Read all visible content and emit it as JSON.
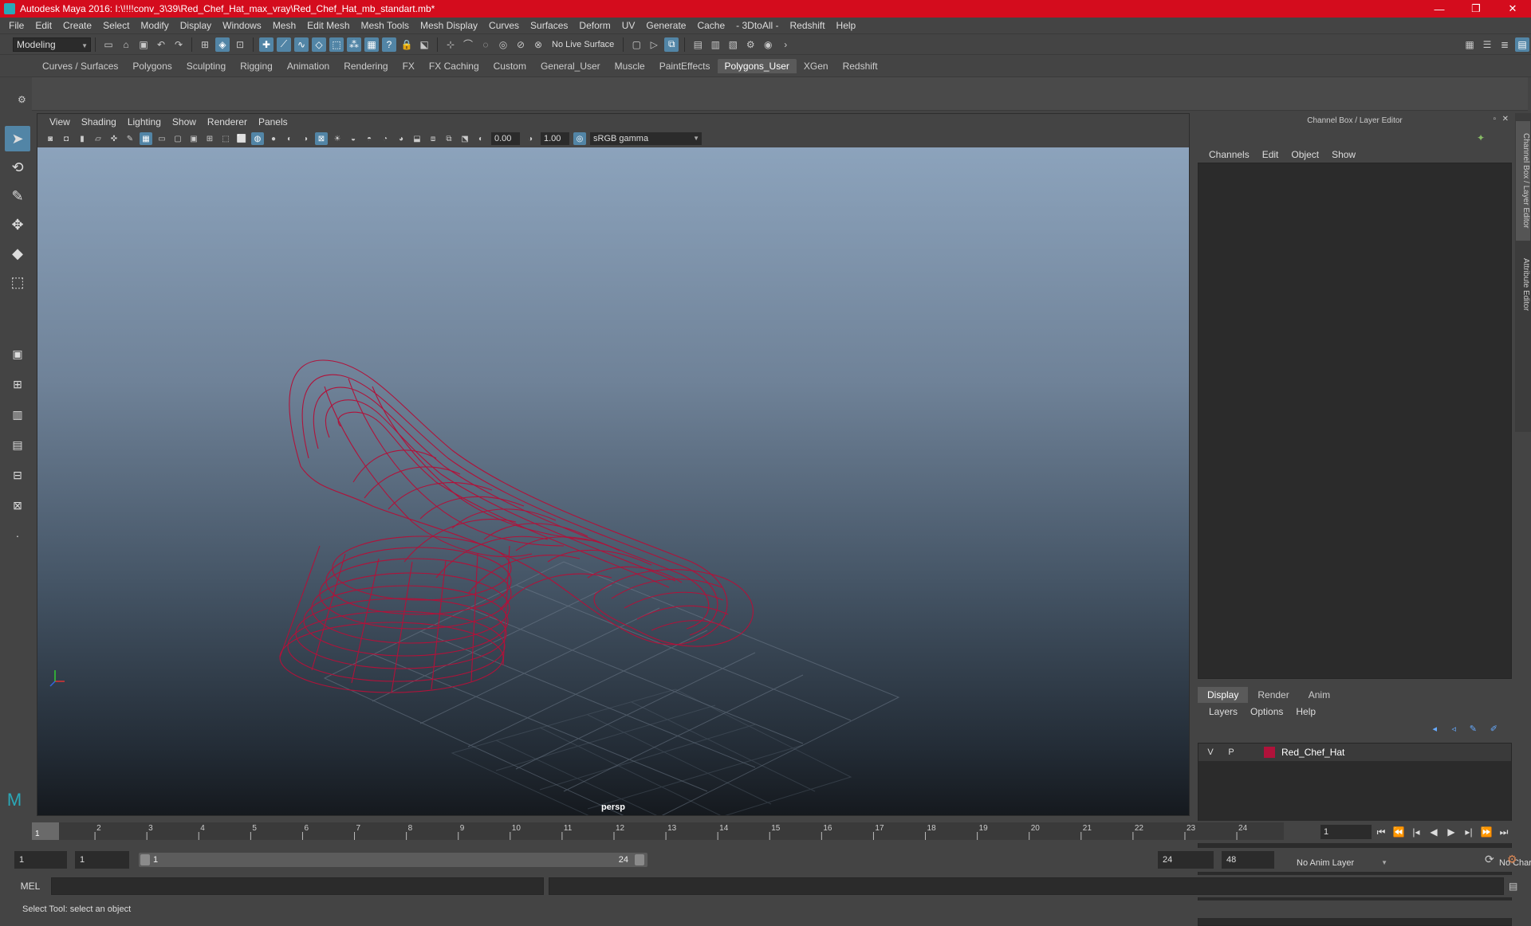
{
  "window": {
    "title": "Autodesk Maya 2016: I:\\!!!!conv_3\\39\\Red_Chef_Hat_max_vray\\Red_Chef_Hat_mb_standart.mb*",
    "minimize": "—",
    "maximize": "❐",
    "close": "✕"
  },
  "menubar": [
    "File",
    "Edit",
    "Create",
    "Select",
    "Modify",
    "Display",
    "Windows",
    "Mesh",
    "Edit Mesh",
    "Mesh Tools",
    "Mesh Display",
    "Curves",
    "Surfaces",
    "Deform",
    "UV",
    "Generate",
    "Cache",
    "- 3DtoAll -",
    "Redshift",
    "Help"
  ],
  "status_line": {
    "mode": "Modeling",
    "live_surface": "No Live Surface"
  },
  "shelf_tabs": [
    "Curves / Surfaces",
    "Polygons",
    "Sculpting",
    "Rigging",
    "Animation",
    "Rendering",
    "FX",
    "FX Caching",
    "Custom",
    "General_User",
    "Muscle",
    "PaintEffects",
    "Polygons_User",
    "XGen",
    "Redshift"
  ],
  "active_shelf_tab": "Polygons_User",
  "viewport": {
    "menus": [
      "View",
      "Shading",
      "Lighting",
      "Show",
      "Renderer",
      "Panels"
    ],
    "exposure": "0.00",
    "gamma": "1.00",
    "color_space": "sRGB gamma",
    "camera_label": "persp",
    "wireframe_color": "#b0123a"
  },
  "channel_box": {
    "title": "Channel Box / Layer Editor",
    "menus": [
      "Channels",
      "Edit",
      "Object",
      "Show"
    ]
  },
  "layer_editor": {
    "tabs": [
      "Display",
      "Render",
      "Anim"
    ],
    "active_tab": "Display",
    "menus": [
      "Layers",
      "Options",
      "Help"
    ],
    "layer": {
      "visible": "V",
      "playback": "P",
      "name": "Red_Chef_Hat",
      "color": "#b0123a"
    }
  },
  "side_tabs": [
    "Channel Box / Layer Editor",
    "Attribute Editor"
  ],
  "time_slider": {
    "ticks": [
      "1",
      "2",
      "3",
      "4",
      "5",
      "6",
      "7",
      "8",
      "9",
      "10",
      "11",
      "12",
      "13",
      "14",
      "15",
      "16",
      "17",
      "18",
      "19",
      "20",
      "21",
      "22",
      "23",
      "24"
    ],
    "current_frame": "1"
  },
  "playback": {
    "current_frame_field": "1"
  },
  "range": {
    "start": "1",
    "playback_start": "1",
    "slider_start": "1",
    "slider_end": "24",
    "playback_end": "24",
    "end": "48",
    "anim_layer": "No Anim Layer",
    "character_set": "No Character Set"
  },
  "command_line": {
    "language": "MEL"
  },
  "help_line": "Select Tool: select an object"
}
